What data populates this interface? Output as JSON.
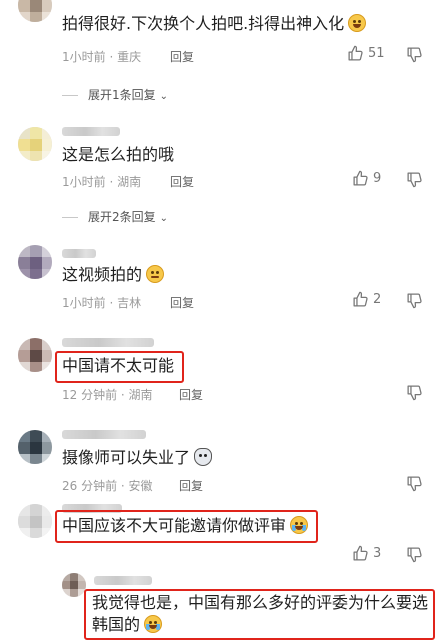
{
  "comments": [
    {
      "text": "拍得很好.下次换个人拍吧.抖得出神入化",
      "emoji": "grin-sweat-emoji",
      "time": "1小时前 · 重庆",
      "reply": "回复",
      "likes": "51"
    },
    {
      "text": "这是怎么拍的哦",
      "time": "1小时前 · 湖南",
      "reply": "回复",
      "likes": "9"
    },
    {
      "text": "这视频拍的",
      "emoji": "smirk-emoji",
      "time": "1小时前 · 吉林",
      "reply": "回复",
      "likes": "2"
    },
    {
      "text": "中国请不太可能",
      "time": "12 分钟前 · 湖南",
      "reply": "回复"
    },
    {
      "text": "摄像师可以失业了",
      "emoji": "husky-emoji",
      "time": "26 分钟前 · 安徽",
      "reply": "回复"
    },
    {
      "text": "中国应该不大可能邀请你做评审",
      "emoji": "rofl-emoji",
      "likes": "3"
    },
    {
      "text": "我觉得也是，中国有那么多好的评委为什么要选韩国的",
      "emoji": "rofl-emoji"
    }
  ],
  "expand_replies": [
    {
      "label": "展开1条回复"
    },
    {
      "label": "展开2条回复"
    }
  ],
  "colors": {
    "highlight": "#e0241b",
    "meta": "#9a9a9a"
  }
}
